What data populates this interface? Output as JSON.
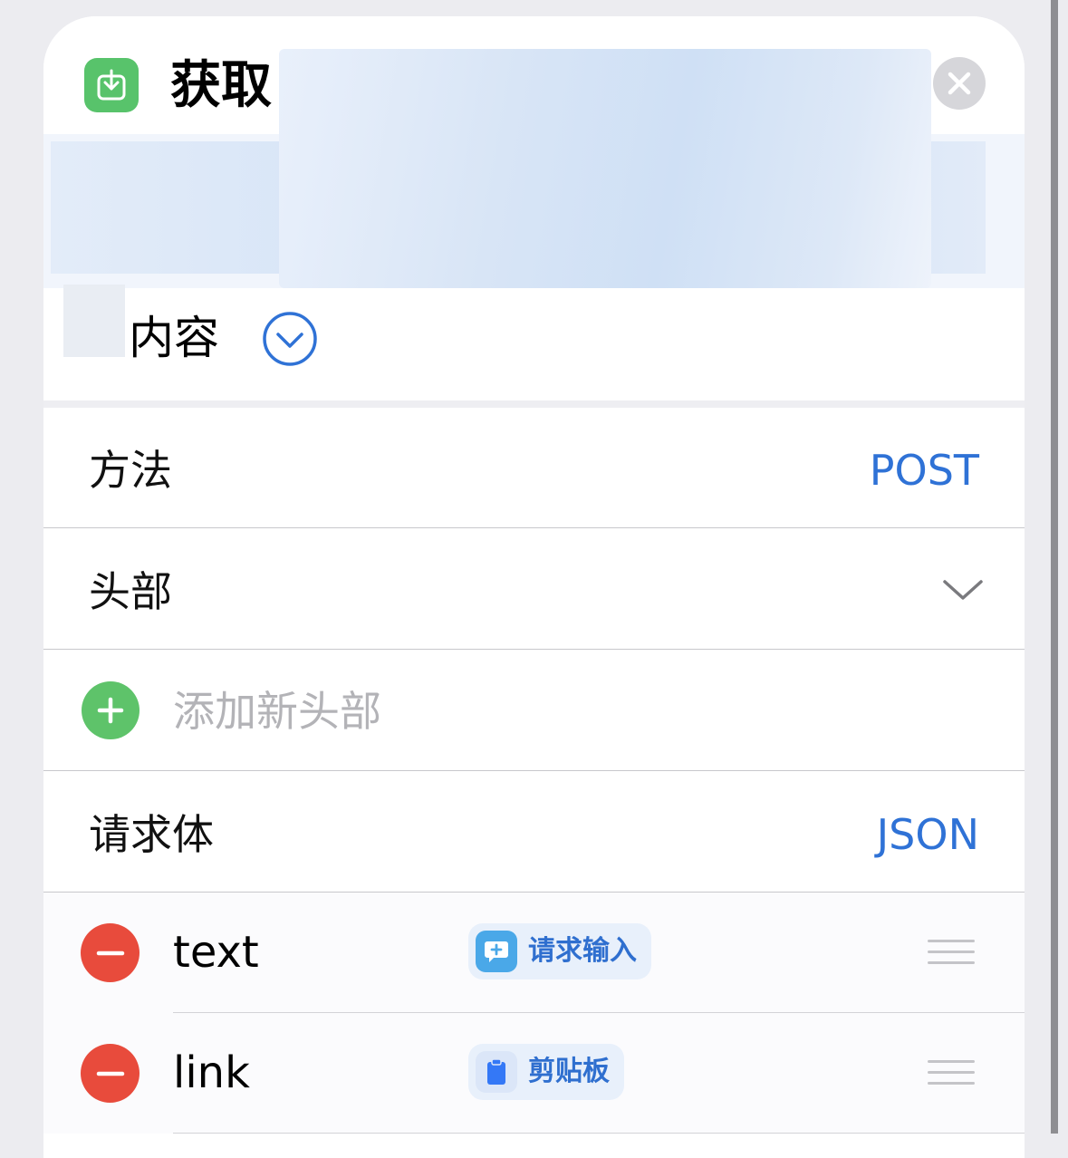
{
  "header": {
    "title": "获取",
    "content_label": "内容"
  },
  "rows": {
    "method_label": "方法",
    "method_value": "POST",
    "headers_label": "头部",
    "add_header_label": "添加新头部",
    "body_label": "请求体",
    "body_value": "JSON"
  },
  "body_items": [
    {
      "key": "text",
      "token_label": "请求输入",
      "token_icon": "speech-bubble-plus-icon",
      "token_color": "#4aa8e8"
    },
    {
      "key": "link",
      "token_label": "剪贴板",
      "token_icon": "clipboard-icon",
      "token_color": "#3478f6"
    }
  ],
  "colors": {
    "accent": "#2f72d6",
    "add_green": "#5ec36a",
    "remove_red": "#e84b3c",
    "app_icon_green": "#58c36b"
  }
}
